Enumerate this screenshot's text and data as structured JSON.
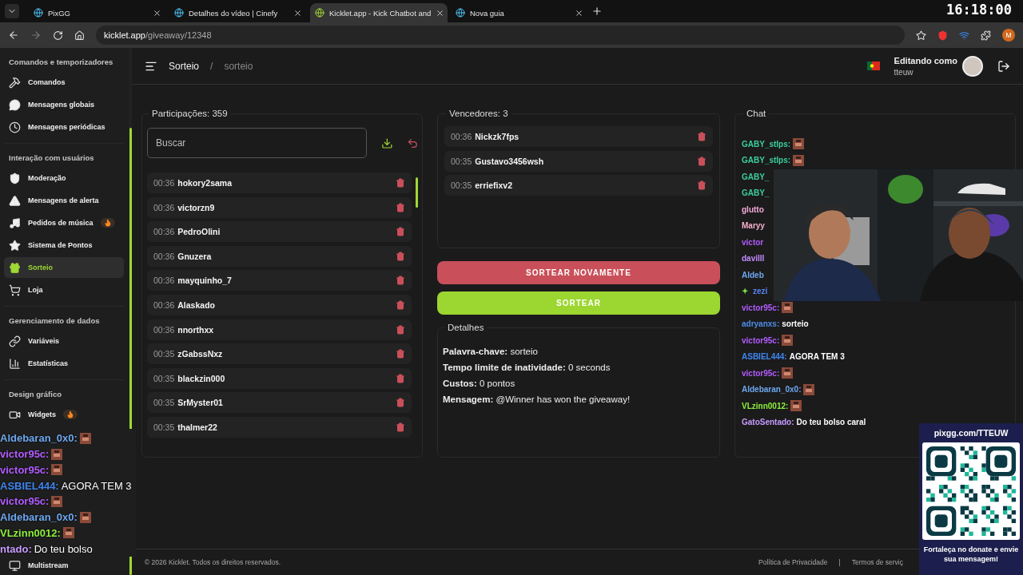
{
  "browser": {
    "tabs": [
      {
        "title": "PixGG",
        "selected": false
      },
      {
        "title": "Detalhes do vídeo | Cinefy",
        "selected": false
      },
      {
        "title": "Kicklet.app - Kick Chatbot and",
        "selected": true
      },
      {
        "title": "Nova guia",
        "selected": false
      }
    ],
    "url_host": "kicklet.app",
    "url_path": "/giveaway/12348",
    "clock": "16:18:00",
    "profile_initial": "M"
  },
  "sidebar": {
    "sections": [
      {
        "title": "Comandos e temporizadores",
        "items": [
          {
            "label": "Comandos",
            "selected": false,
            "hot": false
          },
          {
            "label": "Mensagens globais",
            "selected": false,
            "hot": false
          },
          {
            "label": "Mensagens periódicas",
            "selected": false,
            "hot": false
          }
        ]
      },
      {
        "title": "Interação com usuários",
        "items": [
          {
            "label": "Moderação",
            "selected": false,
            "hot": false
          },
          {
            "label": "Mensagens de alerta",
            "selected": false,
            "hot": false
          },
          {
            "label": "Pedidos de música",
            "selected": false,
            "hot": true
          },
          {
            "label": "Sistema de Pontos",
            "selected": false,
            "hot": false
          },
          {
            "label": "Sorteio",
            "selected": true,
            "hot": false
          },
          {
            "label": "Loja",
            "selected": false,
            "hot": false
          }
        ]
      },
      {
        "title": "Gerenciamento de dados",
        "items": [
          {
            "label": "Variáveis",
            "selected": false,
            "hot": false
          },
          {
            "label": "Estatísticas",
            "selected": false,
            "hot": false
          }
        ]
      },
      {
        "title": "Design gráfico",
        "items": [
          {
            "label": "Widgets",
            "selected": false,
            "hot": true
          }
        ]
      }
    ],
    "bottom_item": {
      "label": "Multistream"
    }
  },
  "header": {
    "breadcrumb": [
      "Sorteio",
      "sorteio"
    ],
    "separator": "/",
    "editing_label": "Editando como",
    "username": "tteuw"
  },
  "participants": {
    "title": "Participações: 359",
    "search": {
      "placeholder": "Buscar"
    },
    "rows": [
      {
        "time": "00:36",
        "name": "hokory2sama"
      },
      {
        "time": "00:36",
        "name": "victorzn9"
      },
      {
        "time": "00:36",
        "name": "PedroOlini"
      },
      {
        "time": "00:36",
        "name": "Gnuzera"
      },
      {
        "time": "00:36",
        "name": "mayquinho_7"
      },
      {
        "time": "00:36",
        "name": "Alaskado"
      },
      {
        "time": "00:36",
        "name": "nnorthxx"
      },
      {
        "time": "00:35",
        "name": "zGabssNxz"
      },
      {
        "time": "00:35",
        "name": "blackzin000"
      },
      {
        "time": "00:35",
        "name": "SrMyster01"
      },
      {
        "time": "00:35",
        "name": "thalmer22"
      }
    ]
  },
  "winners": {
    "title": "Vencedores: 3",
    "rows": [
      {
        "time": "00:36",
        "name": "Nickzk7fps"
      },
      {
        "time": "00:35",
        "name": "Gustavo3456wsh"
      },
      {
        "time": "00:35",
        "name": "erriefixv2"
      }
    ]
  },
  "actions": [
    {
      "label": "SORTEAR NOVAMENTE",
      "kind": "danger"
    },
    {
      "label": "SORTEAR",
      "kind": "primary"
    }
  ],
  "details": {
    "title": "Detalhes",
    "lines": [
      {
        "label": "Palavra-chave:",
        "value": "sorteio"
      },
      {
        "label": "Tempo limite de inatividade:",
        "value": "0 seconds"
      },
      {
        "label": "Custos:",
        "value": "0 pontos"
      },
      {
        "label": "Mensagem:",
        "value": "@Winner has won the giveaway!"
      }
    ]
  },
  "chat": {
    "title": "Chat",
    "messages": [
      {
        "user": "GABY_stlps:",
        "color": "#3ccf9c",
        "emote": true
      },
      {
        "user": "GABY_stlps:",
        "color": "#3ccf9c",
        "emote": true
      },
      {
        "user": "GABY_",
        "color": "#3ccf9c",
        "emote": false
      },
      {
        "user": "GABY_",
        "color": "#3ccf9c",
        "emote": false
      },
      {
        "user": "glutto",
        "color": "#f2a9d8",
        "emote": false
      },
      {
        "user": "Maryy",
        "color": "#f4b0cc",
        "emote": false
      },
      {
        "user": "victor",
        "color": "#b35cff",
        "emote": false
      },
      {
        "user": "davilll",
        "color": "#c28cff",
        "emote": false
      },
      {
        "user": "Aldeb",
        "color": "#6ea8f0",
        "emote": false
      },
      {
        "user": "zezi",
        "color": "#5a86ff",
        "emote": false,
        "badge": "✦"
      },
      {
        "user": "victor95c:",
        "color": "#b35cff",
        "emote": true
      },
      {
        "user": "adryanxs:",
        "color": "#4e8ce8",
        "emote": false,
        "text": "sorteio"
      },
      {
        "user": "victor95c:",
        "color": "#b35cff",
        "emote": true
      },
      {
        "user": "ASBIEL444:",
        "color": "#3f86f0",
        "emote": false,
        "text": "AGORA TEM 3"
      },
      {
        "user": "victor95c:",
        "color": "#b35cff",
        "emote": true
      },
      {
        "user": "Aldebaran_0x0:",
        "color": "#6ea8f0",
        "emote": true
      },
      {
        "user": "VLzinn0012:",
        "color": "#8cf03a",
        "emote": true
      },
      {
        "user": "GatoSentado:",
        "color": "#c79cff",
        "emote": false,
        "text": "Do teu bolso caral"
      }
    ]
  },
  "stream_overlay": {
    "chat": [
      {
        "user": "Aldebaran_0x0:",
        "color": "#6ea8f0",
        "emote": true
      },
      {
        "user": "victor95c:",
        "color": "#b35cff",
        "emote": true
      },
      {
        "user": "victor95c:",
        "color": "#b35cff",
        "emote": true
      },
      {
        "user": "ASBIEL444:",
        "color": "#3f86f0",
        "emote": false,
        "text": "AGORA TEM 3"
      },
      {
        "user": "victor95c:",
        "color": "#b35cff",
        "emote": true
      },
      {
        "user": "Aldebaran_0x0:",
        "color": "#6ea8f0",
        "emote": true
      },
      {
        "user": "VLzinn0012:",
        "color": "#8cf03a",
        "emote": true
      },
      {
        "user": "ntado:",
        "color": "#c79cff",
        "emote": false,
        "text": "Do teu bolso"
      }
    ],
    "donation": {
      "url": "pixgg.com/TTEUW",
      "caption": "Fortaleça no donate e envie sua mensagem!"
    }
  },
  "footer": {
    "copyright": "© 2026 Kicklet. Todos os direitos reservados.",
    "links": [
      "Política de Privacidade",
      "Termos de serviç"
    ],
    "separator": "|"
  }
}
